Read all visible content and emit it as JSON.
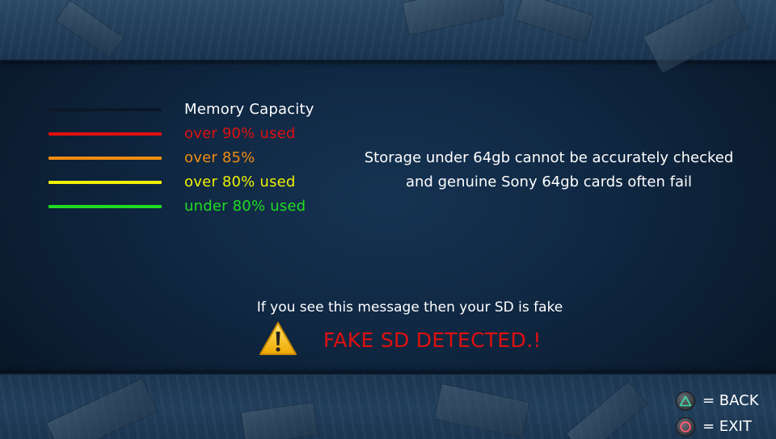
{
  "colors": {
    "memory_capacity": "#0c1826",
    "over_90": "#e01010",
    "over_85": "#f08c10",
    "over_80": "#f0f000",
    "under_80": "#20dc20",
    "fake_text": "#e01010"
  },
  "legend": {
    "items": [
      {
        "label": "Memory Capacity",
        "color": "#0c1826",
        "text_color": "#ffffff"
      },
      {
        "label": "over 90% used",
        "color": "#e01010",
        "text_color": "#e01010"
      },
      {
        "label": "over 85%",
        "color": "#f08c10",
        "text_color": "#f08c10"
      },
      {
        "label": "over 80% used",
        "color": "#f0f000",
        "text_color": "#f0f000"
      },
      {
        "label": "under 80% used",
        "color": "#20dc20",
        "text_color": "#20dc20"
      }
    ]
  },
  "info": {
    "line1": "Storage under 64gb cannot be accurately checked",
    "line2": "and genuine Sony 64gb cards often fail"
  },
  "warning": {
    "message": "If you see this message then your SD is fake",
    "icon": "warning-icon",
    "detected": "FAKE SD DETECTED.!"
  },
  "controls": {
    "back": {
      "icon": "triangle-button-icon",
      "label": "= BACK"
    },
    "exit": {
      "icon": "circle-button-icon",
      "label": "= EXIT"
    }
  }
}
